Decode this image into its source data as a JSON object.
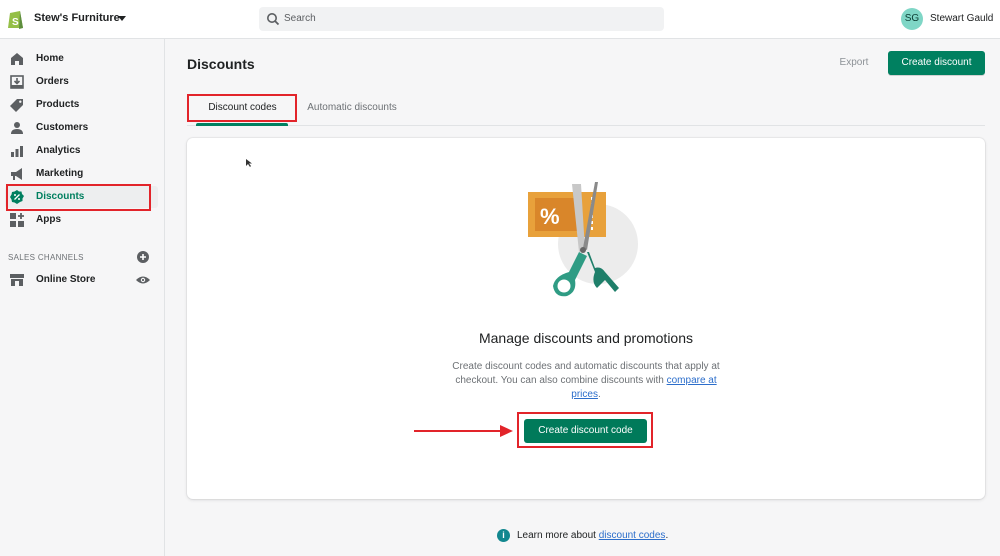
{
  "topbar": {
    "store_name": "Stew's Furniture",
    "search_placeholder": "Search",
    "user_initials": "SG",
    "user_name": "Stewart Gauld"
  },
  "sidebar": {
    "items": [
      {
        "label": "Home",
        "icon": "home-icon"
      },
      {
        "label": "Orders",
        "icon": "orders-icon"
      },
      {
        "label": "Products",
        "icon": "tag-icon"
      },
      {
        "label": "Customers",
        "icon": "person-icon"
      },
      {
        "label": "Analytics",
        "icon": "bar-chart-icon"
      },
      {
        "label": "Marketing",
        "icon": "megaphone-icon"
      },
      {
        "label": "Discounts",
        "icon": "discount-badge-icon",
        "active": true
      },
      {
        "label": "Apps",
        "icon": "apps-icon"
      }
    ],
    "sales_channels_title": "SALES CHANNELS",
    "channels": [
      {
        "label": "Online Store",
        "icon": "store-icon"
      }
    ]
  },
  "page": {
    "title": "Discounts",
    "export_label": "Export",
    "create_label": "Create discount",
    "tabs": [
      {
        "label": "Discount codes",
        "selected": true
      },
      {
        "label": "Automatic discounts",
        "selected": false
      }
    ]
  },
  "empty_state": {
    "heading": "Manage discounts and promotions",
    "body_before": "Create discount codes and automatic discounts that apply at checkout. You can also combine discounts with ",
    "body_link": "compare at prices",
    "body_after": ".",
    "button_label": "Create discount code"
  },
  "footer": {
    "text_before": "Learn more about ",
    "link": "discount codes",
    "text_after": "."
  },
  "colors": {
    "brand_green": "#008060",
    "highlight_red": "#e2242a",
    "link_blue": "#2c6ecb"
  }
}
